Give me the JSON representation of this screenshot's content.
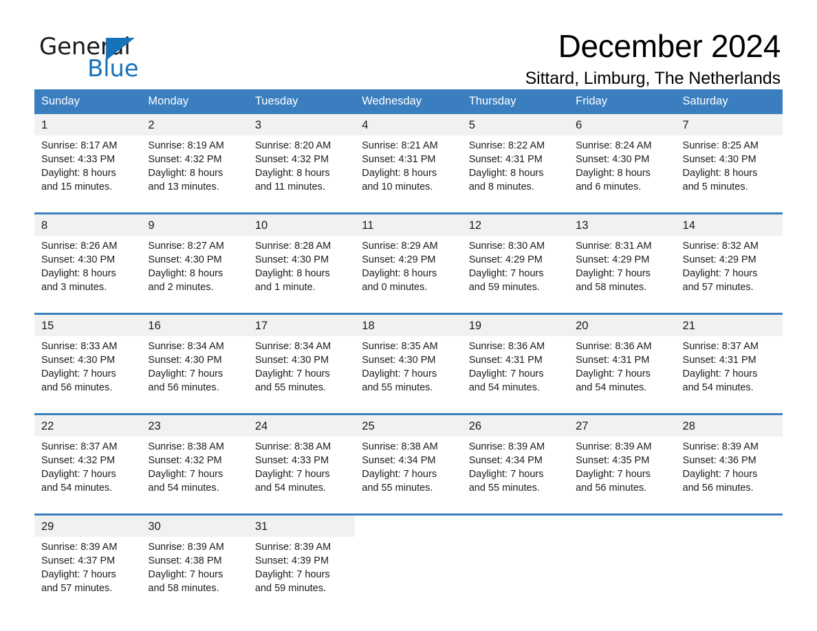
{
  "brand": {
    "name_part1": "General",
    "name_part2": "Blue",
    "logo_icon": "triangle-logo-icon",
    "accent_color": "#1872b8"
  },
  "header": {
    "month_title": "December 2024",
    "location": "Sittard, Limburg, The Netherlands"
  },
  "calendar": {
    "header_bg_color": "#3a7ebf",
    "daynum_bg_color": "#f1f1f1",
    "weekdays": [
      "Sunday",
      "Monday",
      "Tuesday",
      "Wednesday",
      "Thursday",
      "Friday",
      "Saturday"
    ],
    "weeks": [
      [
        {
          "day": "1",
          "sunrise": "Sunrise: 8:17 AM",
          "sunset": "Sunset: 4:33 PM",
          "daylight_line1": "Daylight: 8 hours",
          "daylight_line2": "and 15 minutes."
        },
        {
          "day": "2",
          "sunrise": "Sunrise: 8:19 AM",
          "sunset": "Sunset: 4:32 PM",
          "daylight_line1": "Daylight: 8 hours",
          "daylight_line2": "and 13 minutes."
        },
        {
          "day": "3",
          "sunrise": "Sunrise: 8:20 AM",
          "sunset": "Sunset: 4:32 PM",
          "daylight_line1": "Daylight: 8 hours",
          "daylight_line2": "and 11 minutes."
        },
        {
          "day": "4",
          "sunrise": "Sunrise: 8:21 AM",
          "sunset": "Sunset: 4:31 PM",
          "daylight_line1": "Daylight: 8 hours",
          "daylight_line2": "and 10 minutes."
        },
        {
          "day": "5",
          "sunrise": "Sunrise: 8:22 AM",
          "sunset": "Sunset: 4:31 PM",
          "daylight_line1": "Daylight: 8 hours",
          "daylight_line2": "and 8 minutes."
        },
        {
          "day": "6",
          "sunrise": "Sunrise: 8:24 AM",
          "sunset": "Sunset: 4:30 PM",
          "daylight_line1": "Daylight: 8 hours",
          "daylight_line2": "and 6 minutes."
        },
        {
          "day": "7",
          "sunrise": "Sunrise: 8:25 AM",
          "sunset": "Sunset: 4:30 PM",
          "daylight_line1": "Daylight: 8 hours",
          "daylight_line2": "and 5 minutes."
        }
      ],
      [
        {
          "day": "8",
          "sunrise": "Sunrise: 8:26 AM",
          "sunset": "Sunset: 4:30 PM",
          "daylight_line1": "Daylight: 8 hours",
          "daylight_line2": "and 3 minutes."
        },
        {
          "day": "9",
          "sunrise": "Sunrise: 8:27 AM",
          "sunset": "Sunset: 4:30 PM",
          "daylight_line1": "Daylight: 8 hours",
          "daylight_line2": "and 2 minutes."
        },
        {
          "day": "10",
          "sunrise": "Sunrise: 8:28 AM",
          "sunset": "Sunset: 4:30 PM",
          "daylight_line1": "Daylight: 8 hours",
          "daylight_line2": "and 1 minute."
        },
        {
          "day": "11",
          "sunrise": "Sunrise: 8:29 AM",
          "sunset": "Sunset: 4:29 PM",
          "daylight_line1": "Daylight: 8 hours",
          "daylight_line2": "and 0 minutes."
        },
        {
          "day": "12",
          "sunrise": "Sunrise: 8:30 AM",
          "sunset": "Sunset: 4:29 PM",
          "daylight_line1": "Daylight: 7 hours",
          "daylight_line2": "and 59 minutes."
        },
        {
          "day": "13",
          "sunrise": "Sunrise: 8:31 AM",
          "sunset": "Sunset: 4:29 PM",
          "daylight_line1": "Daylight: 7 hours",
          "daylight_line2": "and 58 minutes."
        },
        {
          "day": "14",
          "sunrise": "Sunrise: 8:32 AM",
          "sunset": "Sunset: 4:29 PM",
          "daylight_line1": "Daylight: 7 hours",
          "daylight_line2": "and 57 minutes."
        }
      ],
      [
        {
          "day": "15",
          "sunrise": "Sunrise: 8:33 AM",
          "sunset": "Sunset: 4:30 PM",
          "daylight_line1": "Daylight: 7 hours",
          "daylight_line2": "and 56 minutes."
        },
        {
          "day": "16",
          "sunrise": "Sunrise: 8:34 AM",
          "sunset": "Sunset: 4:30 PM",
          "daylight_line1": "Daylight: 7 hours",
          "daylight_line2": "and 56 minutes."
        },
        {
          "day": "17",
          "sunrise": "Sunrise: 8:34 AM",
          "sunset": "Sunset: 4:30 PM",
          "daylight_line1": "Daylight: 7 hours",
          "daylight_line2": "and 55 minutes."
        },
        {
          "day": "18",
          "sunrise": "Sunrise: 8:35 AM",
          "sunset": "Sunset: 4:30 PM",
          "daylight_line1": "Daylight: 7 hours",
          "daylight_line2": "and 55 minutes."
        },
        {
          "day": "19",
          "sunrise": "Sunrise: 8:36 AM",
          "sunset": "Sunset: 4:31 PM",
          "daylight_line1": "Daylight: 7 hours",
          "daylight_line2": "and 54 minutes."
        },
        {
          "day": "20",
          "sunrise": "Sunrise: 8:36 AM",
          "sunset": "Sunset: 4:31 PM",
          "daylight_line1": "Daylight: 7 hours",
          "daylight_line2": "and 54 minutes."
        },
        {
          "day": "21",
          "sunrise": "Sunrise: 8:37 AM",
          "sunset": "Sunset: 4:31 PM",
          "daylight_line1": "Daylight: 7 hours",
          "daylight_line2": "and 54 minutes."
        }
      ],
      [
        {
          "day": "22",
          "sunrise": "Sunrise: 8:37 AM",
          "sunset": "Sunset: 4:32 PM",
          "daylight_line1": "Daylight: 7 hours",
          "daylight_line2": "and 54 minutes."
        },
        {
          "day": "23",
          "sunrise": "Sunrise: 8:38 AM",
          "sunset": "Sunset: 4:32 PM",
          "daylight_line1": "Daylight: 7 hours",
          "daylight_line2": "and 54 minutes."
        },
        {
          "day": "24",
          "sunrise": "Sunrise: 8:38 AM",
          "sunset": "Sunset: 4:33 PM",
          "daylight_line1": "Daylight: 7 hours",
          "daylight_line2": "and 54 minutes."
        },
        {
          "day": "25",
          "sunrise": "Sunrise: 8:38 AM",
          "sunset": "Sunset: 4:34 PM",
          "daylight_line1": "Daylight: 7 hours",
          "daylight_line2": "and 55 minutes."
        },
        {
          "day": "26",
          "sunrise": "Sunrise: 8:39 AM",
          "sunset": "Sunset: 4:34 PM",
          "daylight_line1": "Daylight: 7 hours",
          "daylight_line2": "and 55 minutes."
        },
        {
          "day": "27",
          "sunrise": "Sunrise: 8:39 AM",
          "sunset": "Sunset: 4:35 PM",
          "daylight_line1": "Daylight: 7 hours",
          "daylight_line2": "and 56 minutes."
        },
        {
          "day": "28",
          "sunrise": "Sunrise: 8:39 AM",
          "sunset": "Sunset: 4:36 PM",
          "daylight_line1": "Daylight: 7 hours",
          "daylight_line2": "and 56 minutes."
        }
      ],
      [
        {
          "day": "29",
          "sunrise": "Sunrise: 8:39 AM",
          "sunset": "Sunset: 4:37 PM",
          "daylight_line1": "Daylight: 7 hours",
          "daylight_line2": "and 57 minutes."
        },
        {
          "day": "30",
          "sunrise": "Sunrise: 8:39 AM",
          "sunset": "Sunset: 4:38 PM",
          "daylight_line1": "Daylight: 7 hours",
          "daylight_line2": "and 58 minutes."
        },
        {
          "day": "31",
          "sunrise": "Sunrise: 8:39 AM",
          "sunset": "Sunset: 4:39 PM",
          "daylight_line1": "Daylight: 7 hours",
          "daylight_line2": "and 59 minutes."
        },
        {
          "day": "",
          "sunrise": "",
          "sunset": "",
          "daylight_line1": "",
          "daylight_line2": ""
        },
        {
          "day": "",
          "sunrise": "",
          "sunset": "",
          "daylight_line1": "",
          "daylight_line2": ""
        },
        {
          "day": "",
          "sunrise": "",
          "sunset": "",
          "daylight_line1": "",
          "daylight_line2": ""
        },
        {
          "day": "",
          "sunrise": "",
          "sunset": "",
          "daylight_line1": "",
          "daylight_line2": ""
        }
      ]
    ]
  }
}
